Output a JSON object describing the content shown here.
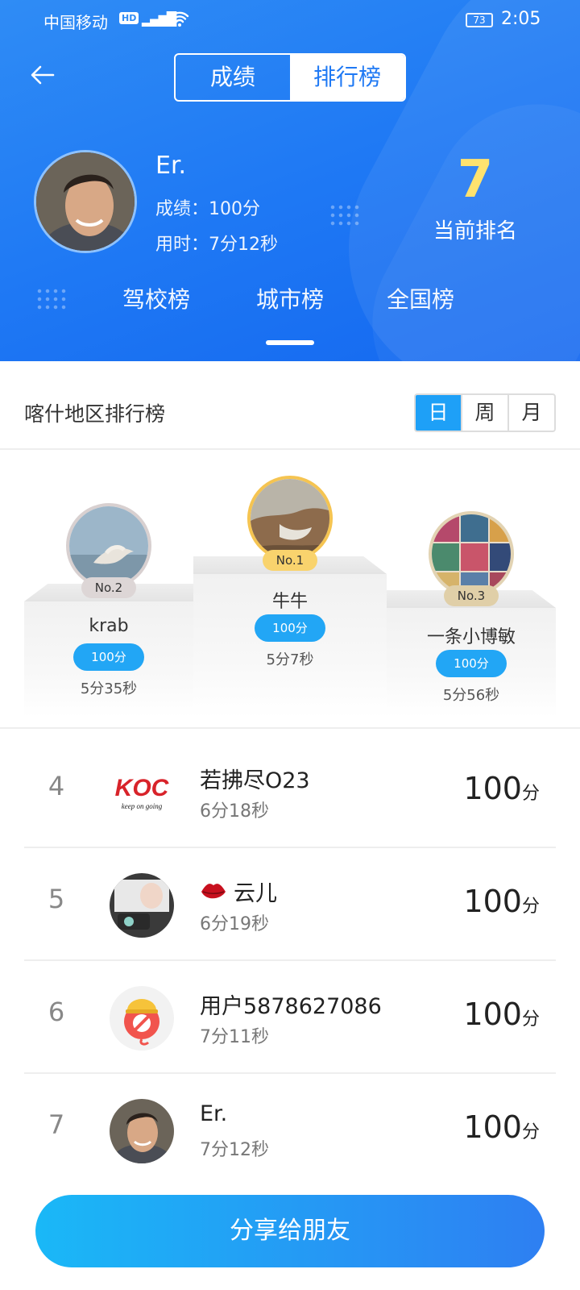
{
  "status_bar": {
    "carrier": "中国移动",
    "hd": "HD",
    "network": "4G",
    "battery": "73",
    "time": "2:05"
  },
  "header": {
    "segments": [
      "成绩",
      "排行榜"
    ],
    "active_segment": 1,
    "user": {
      "name": "Er.",
      "score": "成绩：100分",
      "time": "用时：7分12秒"
    },
    "rank": {
      "value": "7",
      "label": "当前排名"
    },
    "board_tabs": [
      "驾校榜",
      "城市榜",
      "全国榜"
    ],
    "active_board_tab": 1
  },
  "region": {
    "title": "喀什地区排行榜",
    "periods": [
      "日",
      "周",
      "月"
    ],
    "active_period": 0
  },
  "podium": {
    "first": {
      "rank": "No.1",
      "name": "牛牛",
      "score": "100分",
      "time": "5分7秒"
    },
    "second": {
      "rank": "No.2",
      "name": "krab",
      "score": "100分",
      "time": "5分35秒"
    },
    "third": {
      "rank": "No.3",
      "name": "一条小博敏",
      "score": "100分",
      "time": "5分56秒"
    }
  },
  "list": [
    {
      "rank": "4",
      "name": "若拂尽O23",
      "time": "6分18秒",
      "score": "100",
      "unit": "分",
      "avatar": "koc-logo"
    },
    {
      "rank": "5",
      "name": "云儿",
      "time": "6分19秒",
      "score": "100",
      "unit": "分",
      "avatar": "photo",
      "name_icon": "lips-icon"
    },
    {
      "rank": "6",
      "name": "用户5878627086",
      "time": "7分11秒",
      "score": "100",
      "unit": "分",
      "avatar": "mascot"
    },
    {
      "rank": "7",
      "name": "Er.",
      "time": "7分12秒",
      "score": "100",
      "unit": "分",
      "avatar": "photo"
    }
  ],
  "share_button": "分享给朋友",
  "colors": {
    "header_blue": "#1f79f4",
    "accent": "#22a6f5",
    "rank_gold": "#ffe26e",
    "first_border": "#f5c451",
    "second_border": "#d8d0d0",
    "third_border": "#e2d3b3"
  }
}
